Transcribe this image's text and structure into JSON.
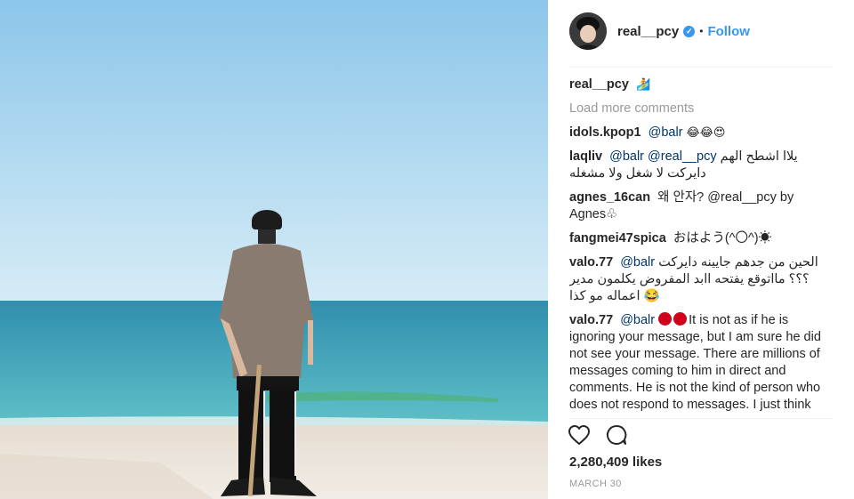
{
  "post": {
    "username": "real__pcy",
    "follow_label": "Follow",
    "dot": "•",
    "caption_user": "real__pcy",
    "caption_emoji": "🏄",
    "load_more": "Load more comments",
    "likes": "2,280,409 likes",
    "date": "MARCH 30"
  },
  "comments": [
    {
      "user": "idols.kpop1",
      "mention": "@balr",
      "text": " 😂😂😍"
    },
    {
      "user": "laqliv",
      "mention": "@balr @real__pcy",
      "text": " يلاا اشطح الهم دايركت لا شغل ولا مشغله"
    },
    {
      "user": "agnes_16can",
      "mention": "",
      "text": "왜 안자? @real__pcy by Agnes♧"
    },
    {
      "user": "fangmei47spica",
      "mention": "",
      "text": "おはよう(^〇^)☀"
    },
    {
      "user": "valo.77",
      "mention": "@balr",
      "text": " الحين من جدهم جايينه دايركت ؟؟؟ مااتوقع يفتحه اابد المفروض يكلمون مدير اعماله مو كذا 😂"
    },
    {
      "user": "valo.77",
      "mention": "@balr",
      "text": "It is not as if he is ignoring your message, but I am sure he did not see your message. There are millions of messages coming to him in direct and comments. He is not the kind of person who does not respond to messages. I just think you should coordinate with their manager."
    }
  ],
  "icons": {
    "like": "heart-icon",
    "comment": "comment-bubble-icon",
    "verified": "verified-badge-icon"
  },
  "colors": {
    "link": "#3897f0",
    "text": "#262626",
    "muted": "#999999"
  }
}
